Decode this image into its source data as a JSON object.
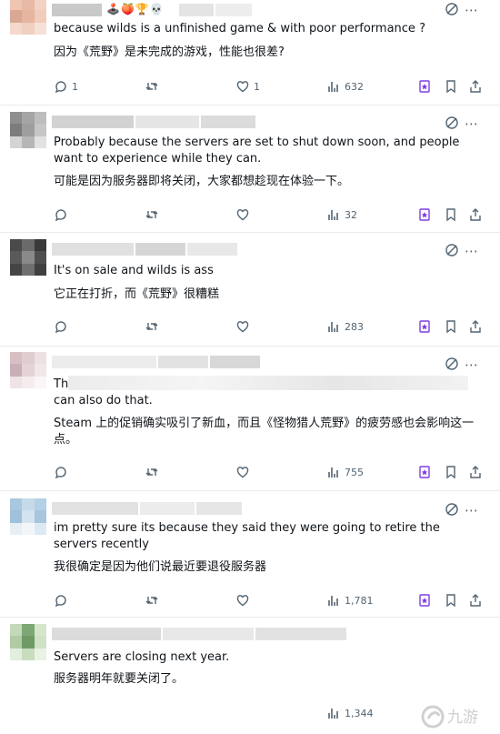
{
  "replies": [
    {
      "emoji": "🕹️🍑🏆💀",
      "en": "because wilds is a unfinished game & with poor performance ?",
      "zh": "因为《荒野》是未完成的游戏，性能也很差?",
      "replies_count": "1",
      "likes_count": "1",
      "views_count": "632"
    },
    {
      "en": "Probably because the servers are set to shut down soon, and people want to experience while they can.",
      "zh": "可能是因为服务器即将关闭，大家都想趁现在体验一下。",
      "views_count": "32"
    },
    {
      "en": "It's on sale and wilds is ass",
      "zh": "它正在打折，而《荒野》很糟糕",
      "views_count": "283"
    },
    {
      "en_prefix": "Th",
      "en_suffix": "can also do that.",
      "zh": "Steam 上的促销确实吸引了新血，而且《怪物猎人荒野》的疲劳感也会影响这一点。",
      "views_count": "755"
    },
    {
      "en": "im pretty sure its because they said they were going to retire the servers recently",
      "zh": "我很确定是因为他们说最近要退役服务器",
      "views_count": "1,781"
    },
    {
      "en": "Servers are closing next year.",
      "zh": "服务器明年就要关闭了。",
      "views_count": "1,344"
    }
  ],
  "watermark": "九游",
  "colors": {
    "text": "#0f1419",
    "muted": "#536471",
    "bookmark_accent": "#7d3ee0"
  }
}
